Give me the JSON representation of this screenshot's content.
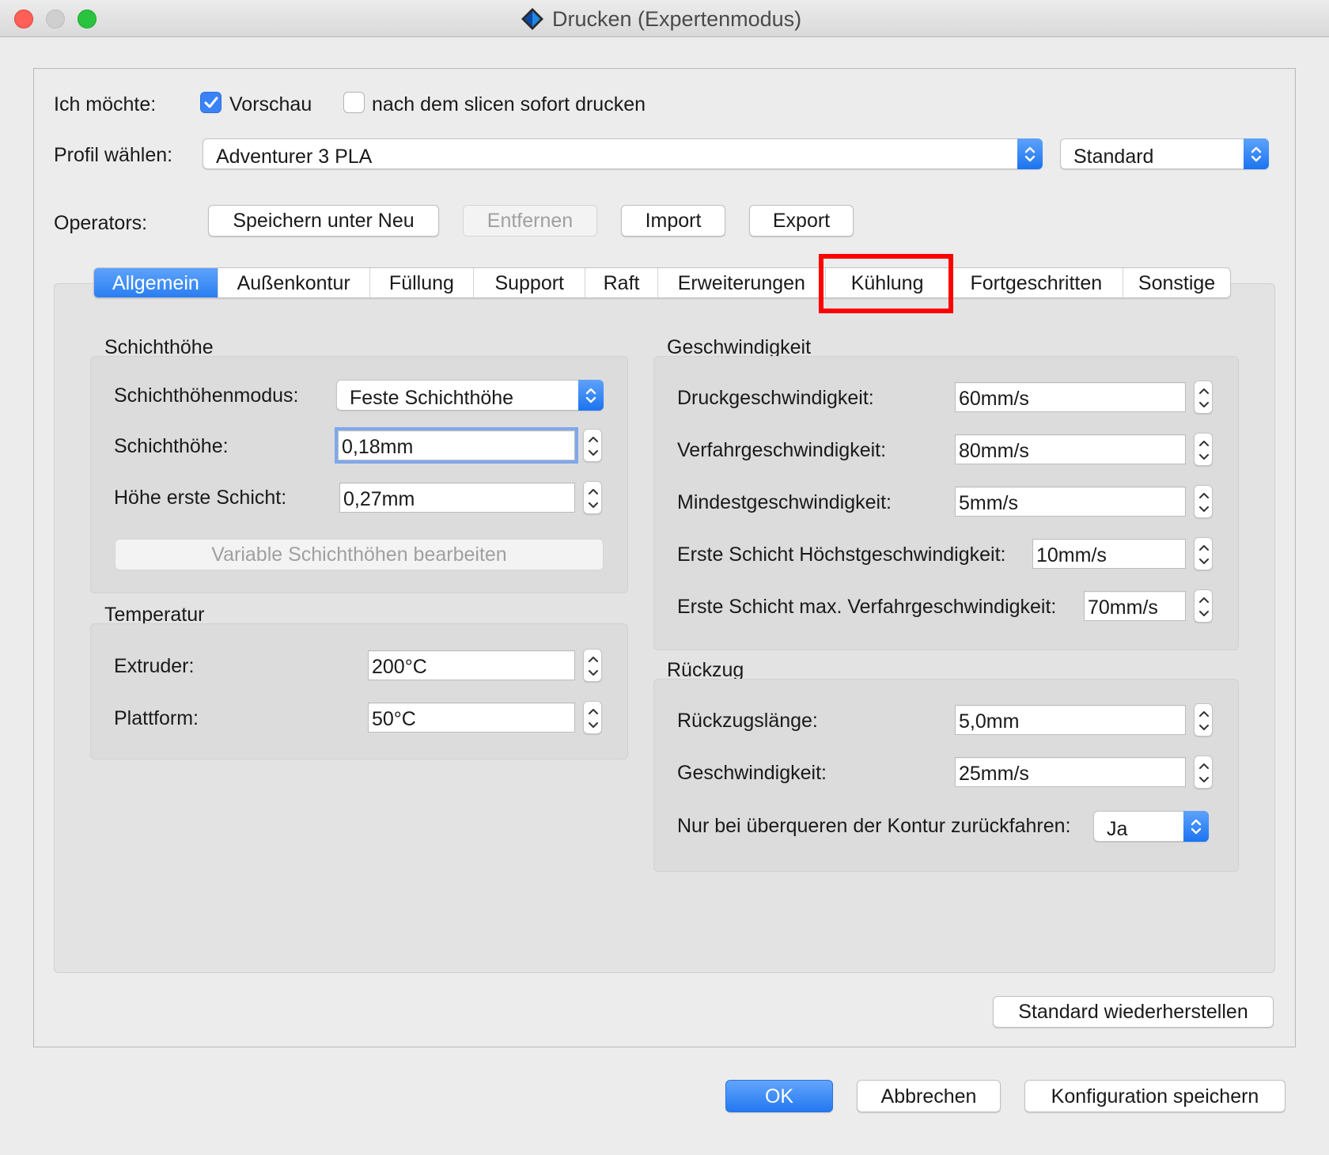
{
  "window": {
    "title": "Drucken (Expertenmodus)"
  },
  "intent": {
    "label": "Ich möchte:",
    "preview": {
      "label": "Vorschau",
      "checked": true
    },
    "print_after_slice": {
      "label": "nach dem slicen sofort drucken",
      "checked": false
    }
  },
  "profile": {
    "label": "Profil wählen:",
    "selected": "Adventurer 3 PLA",
    "variant": "Standard"
  },
  "operators": {
    "label": "Operators:",
    "save_new": "Speichern unter Neu",
    "remove": "Entfernen",
    "import": "Import",
    "export": "Export"
  },
  "tabs": [
    {
      "label": "Allgemein",
      "active": true
    },
    {
      "label": "Außenkontur"
    },
    {
      "label": "Füllung"
    },
    {
      "label": "Support"
    },
    {
      "label": "Raft"
    },
    {
      "label": "Erweiterungen"
    },
    {
      "label": "Kühlung",
      "highlighted": true
    },
    {
      "label": "Fortgeschritten"
    },
    {
      "label": "Sonstige"
    }
  ],
  "layer_height": {
    "title": "Schichthöhe",
    "mode_label": "Schichthöhenmodus:",
    "mode_value": "Feste Schichthöhe",
    "height_label": "Schichthöhe:",
    "height_value": "0,18mm",
    "first_label": "Höhe erste Schicht:",
    "first_value": "0,27mm",
    "variable_button": "Variable Schichthöhen bearbeiten"
  },
  "temperature": {
    "title": "Temperatur",
    "extruder_label": "Extruder:",
    "extruder_value": "200°C",
    "platform_label": "Plattform:",
    "platform_value": "50°C"
  },
  "speed": {
    "title": "Geschwindigkeit",
    "print_label": "Druckgeschwindigkeit:",
    "print_value": "60mm/s",
    "travel_label": "Verfahrgeschwindigkeit:",
    "travel_value": "80mm/s",
    "min_label": "Mindestgeschwindigkeit:",
    "min_value": "5mm/s",
    "first_max_label": "Erste Schicht Höchstgeschwindigkeit:",
    "first_max_value": "10mm/s",
    "first_travel_label": "Erste Schicht max. Verfahrgeschwindigkeit:",
    "first_travel_value": "70mm/s"
  },
  "retraction": {
    "title": "Rückzug",
    "length_label": "Rückzugslänge:",
    "length_value": "5,0mm",
    "speed_label": "Geschwindigkeit:",
    "speed_value": "25mm/s",
    "contour_label": "Nur bei überqueren der Kontur zurückfahren:",
    "contour_value": "Ja"
  },
  "restore_defaults": "Standard wiederherstellen",
  "footer": {
    "ok": "OK",
    "cancel": "Abbrechen",
    "save_config": "Konfiguration speichern"
  },
  "colors": {
    "accent": "#3a82f7",
    "highlight_box": "#ff0000"
  }
}
